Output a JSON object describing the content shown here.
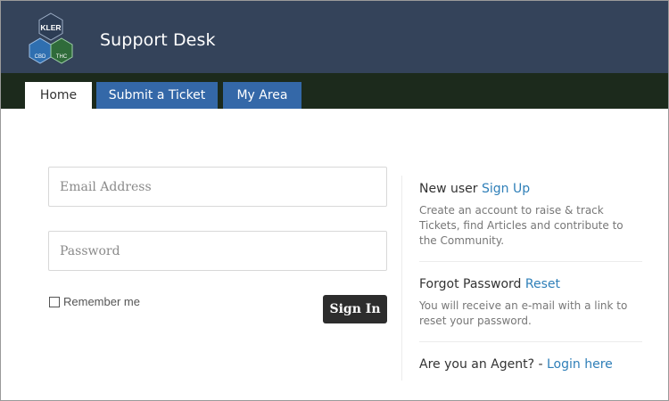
{
  "header": {
    "logo": {
      "top_text": "KLER",
      "left_text": "CBD",
      "right_text": "THC"
    },
    "title": "Support Desk"
  },
  "tabs": [
    {
      "label": "Home",
      "active": true
    },
    {
      "label": "Submit a Ticket",
      "active": false
    },
    {
      "label": "My Area",
      "active": false
    }
  ],
  "login": {
    "email_placeholder": "Email Address",
    "password_placeholder": "Password",
    "remember_label": "Remember me",
    "signin_label": "Sign In"
  },
  "side": {
    "new_user": {
      "prefix": "New user ",
      "link": "Sign Up",
      "desc": "Create an account to raise & track Tickets, find Articles and contribute to the Community."
    },
    "forgot": {
      "prefix": "Forgot Password ",
      "link": "Reset",
      "desc": "You will receive an e-mail with a link to reset your password."
    },
    "agent": {
      "prefix": "Are you an Agent? - ",
      "link": "Login here"
    }
  },
  "colors": {
    "header_bg": "#34435a",
    "tabbar_bg": "#1c2a1c",
    "tab_blue": "#3468a8",
    "link_blue": "#2f7fb8",
    "button_dark": "#2d2d2d"
  }
}
